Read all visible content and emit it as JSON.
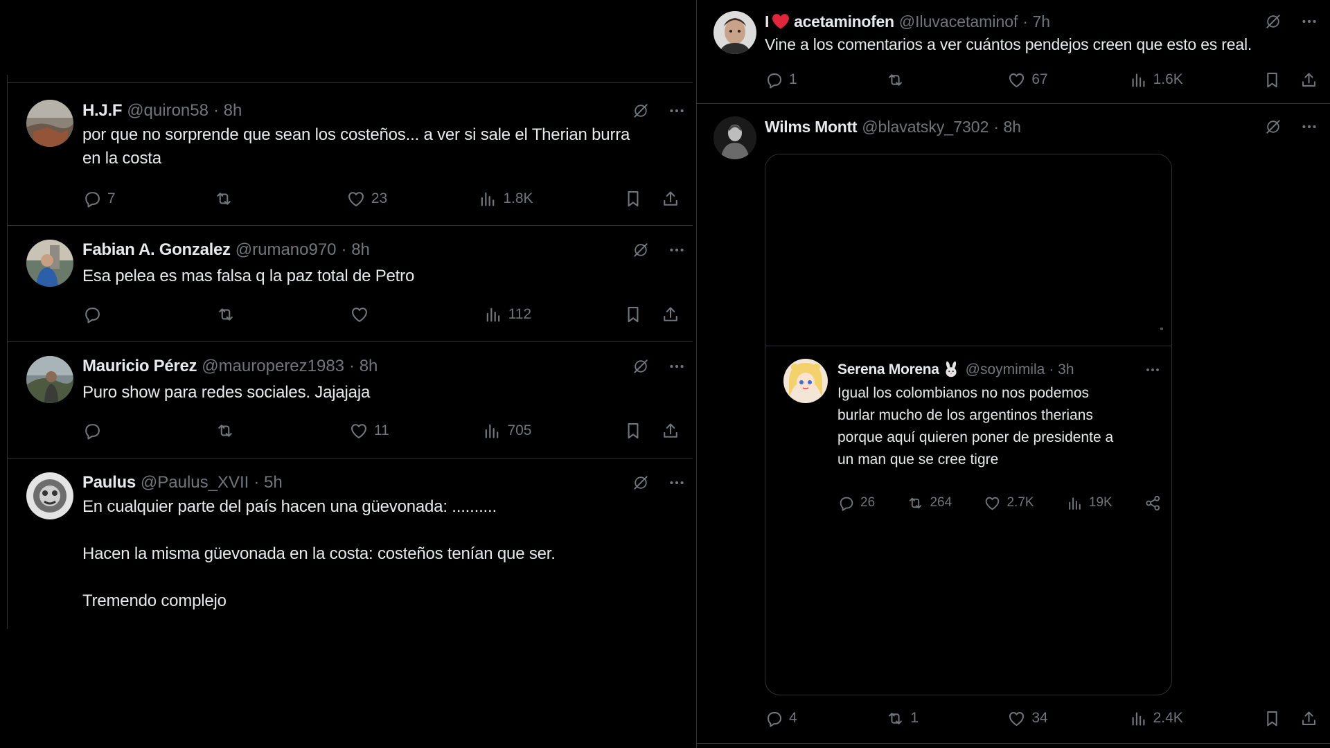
{
  "left_tweets": [
    {
      "name": "H.J.F",
      "handle": "@quiron58",
      "time": "· 8h",
      "lines": [
        "por que no sorprende que sean los costeños... a ver si sale el Therian burra",
        "en la costa"
      ],
      "replies": "7",
      "retweets": "",
      "likes": "23",
      "views": "1.8K"
    },
    {
      "name": "Fabian A. Gonzalez",
      "handle": "@rumano970",
      "time": "· 8h",
      "lines": [
        "Esa pelea es mas falsa q la paz total de Petro"
      ],
      "replies": "",
      "retweets": "",
      "likes": "",
      "views": "112"
    },
    {
      "name": "Mauricio Pérez",
      "handle": "@mauroperez1983",
      "time": "· 8h",
      "lines": [
        "Puro show para redes sociales. Jajajaja"
      ],
      "replies": "",
      "retweets": "",
      "likes": "11",
      "views": "705"
    },
    {
      "name": "Paulus",
      "handle": "@Paulus_XVII",
      "time": "· 5h",
      "lines": [
        "En cualquier parte del país hacen una güevonada: ..........",
        "",
        "Hacen la misma güevonada en la costa: costeños tenían que ser.",
        "",
        "Tremendo complejo"
      ]
    }
  ],
  "right_tweets": [
    {
      "name_prefix": "I",
      "name": "acetaminofen",
      "handle": "@Iluvacetaminof",
      "time": "· 7h",
      "text": "Vine a  los comentarios a ver cuántos pendejos creen que esto es real.",
      "replies": "1",
      "retweets": "",
      "likes": "67",
      "views": "1.6K"
    },
    {
      "name": "Wilms Montt",
      "handle": "@blavatsky_7302",
      "time": "· 8h",
      "replies": "4",
      "retweets": "1",
      "likes": "34",
      "views": "2.4K",
      "quote": {
        "name": "Serena Morena",
        "handle": "@soymimila",
        "time": "· 3h",
        "lines": [
          "Igual los colombianos no nos podemos",
          "burlar mucho de los argentinos therians",
          "porque aquí quieren poner de presidente a",
          "un man que se cree tigre"
        ],
        "replies": "26",
        "retweets": "264",
        "likes": "2.7K",
        "views": "19K"
      }
    }
  ],
  "colors": {
    "background": "#000000",
    "text": "#e7e9ea",
    "muted": "#71767b",
    "border": "#2f3336",
    "heart": "#f91880"
  }
}
